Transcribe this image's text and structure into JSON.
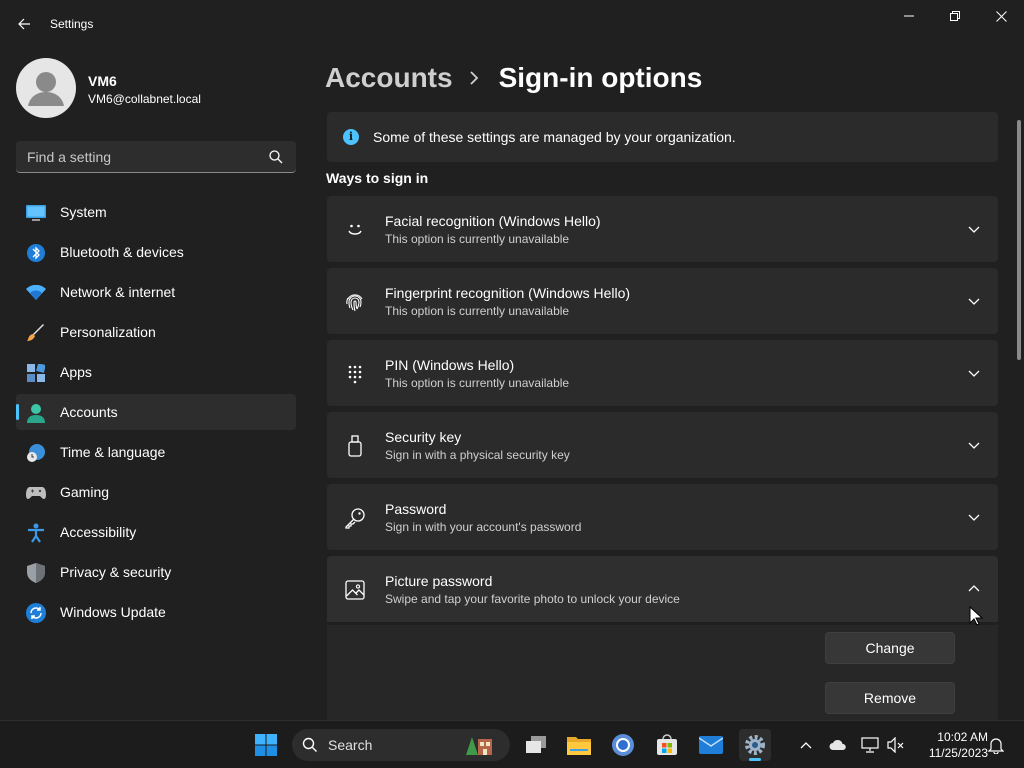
{
  "window": {
    "app_title": "Settings"
  },
  "profile": {
    "name": "VM6",
    "email": "VM6@collabnet.local"
  },
  "search": {
    "placeholder": "Find a setting"
  },
  "sidebar": {
    "items": [
      {
        "label": "System",
        "icon": "system-icon"
      },
      {
        "label": "Bluetooth & devices",
        "icon": "bluetooth-icon"
      },
      {
        "label": "Network & internet",
        "icon": "wifi-icon"
      },
      {
        "label": "Personalization",
        "icon": "brush-icon"
      },
      {
        "label": "Apps",
        "icon": "apps-icon"
      },
      {
        "label": "Accounts",
        "icon": "accounts-icon",
        "active": true
      },
      {
        "label": "Time & language",
        "icon": "clock-globe-icon"
      },
      {
        "label": "Gaming",
        "icon": "gamepad-icon"
      },
      {
        "label": "Accessibility",
        "icon": "accessibility-icon"
      },
      {
        "label": "Privacy & security",
        "icon": "shield-icon"
      },
      {
        "label": "Windows Update",
        "icon": "update-icon"
      }
    ]
  },
  "breadcrumb": {
    "parent": "Accounts",
    "current": "Sign-in options"
  },
  "info": {
    "text": "Some of these settings are managed by your organization."
  },
  "section": {
    "title": "Ways to sign in"
  },
  "cards": [
    {
      "title": "Facial recognition (Windows Hello)",
      "subtitle": "This option is currently unavailable",
      "icon": "face-icon",
      "expanded": false
    },
    {
      "title": "Fingerprint recognition (Windows Hello)",
      "subtitle": "This option is currently unavailable",
      "icon": "fingerprint-icon",
      "expanded": false
    },
    {
      "title": "PIN (Windows Hello)",
      "subtitle": "This option is currently unavailable",
      "icon": "pin-keypad-icon",
      "expanded": false
    },
    {
      "title": "Security key",
      "subtitle": "Sign in with a physical security key",
      "icon": "usb-key-icon",
      "expanded": false
    },
    {
      "title": "Password",
      "subtitle": "Sign in with your account's password",
      "icon": "key-icon",
      "expanded": false
    },
    {
      "title": "Picture password",
      "subtitle": "Swipe and tap your favorite photo to unlock your device",
      "icon": "picture-icon",
      "expanded": true
    }
  ],
  "picture_password_actions": {
    "change_label": "Change",
    "remove_label": "Remove"
  },
  "taskbar": {
    "search_label": "Search",
    "time": "10:02 AM",
    "date": "11/25/2023"
  },
  "colors": {
    "accent": "#4cc2ff",
    "background": "#202020",
    "card": "#2b2b2b"
  }
}
